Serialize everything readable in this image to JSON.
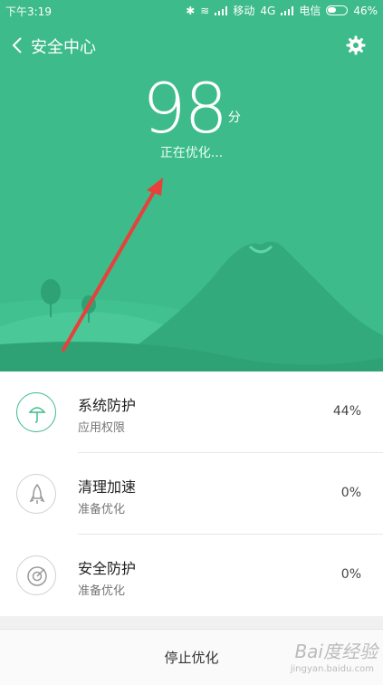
{
  "status_bar": {
    "time": "下午3:19",
    "carrier1": "移动",
    "network1": "4G",
    "carrier2": "电信",
    "battery": "46%"
  },
  "header": {
    "title": "安全中心"
  },
  "score": {
    "value": "98",
    "unit": "分",
    "status": "正在优化..."
  },
  "items": [
    {
      "title": "系统防护",
      "subtitle": "应用权限",
      "value": "44%",
      "icon": "umbrella-icon"
    },
    {
      "title": "清理加速",
      "subtitle": "准备优化",
      "value": "0%",
      "icon": "rocket-icon"
    },
    {
      "title": "安全防护",
      "subtitle": "准备优化",
      "value": "0%",
      "icon": "radar-icon"
    }
  ],
  "footer": {
    "stop_label": "停止优化"
  },
  "watermark": {
    "text": "Bai度经验",
    "sub": "jingyan.baidu.com"
  },
  "colors": {
    "accent": "#3dbb8a",
    "arrow": "#e8403a"
  }
}
